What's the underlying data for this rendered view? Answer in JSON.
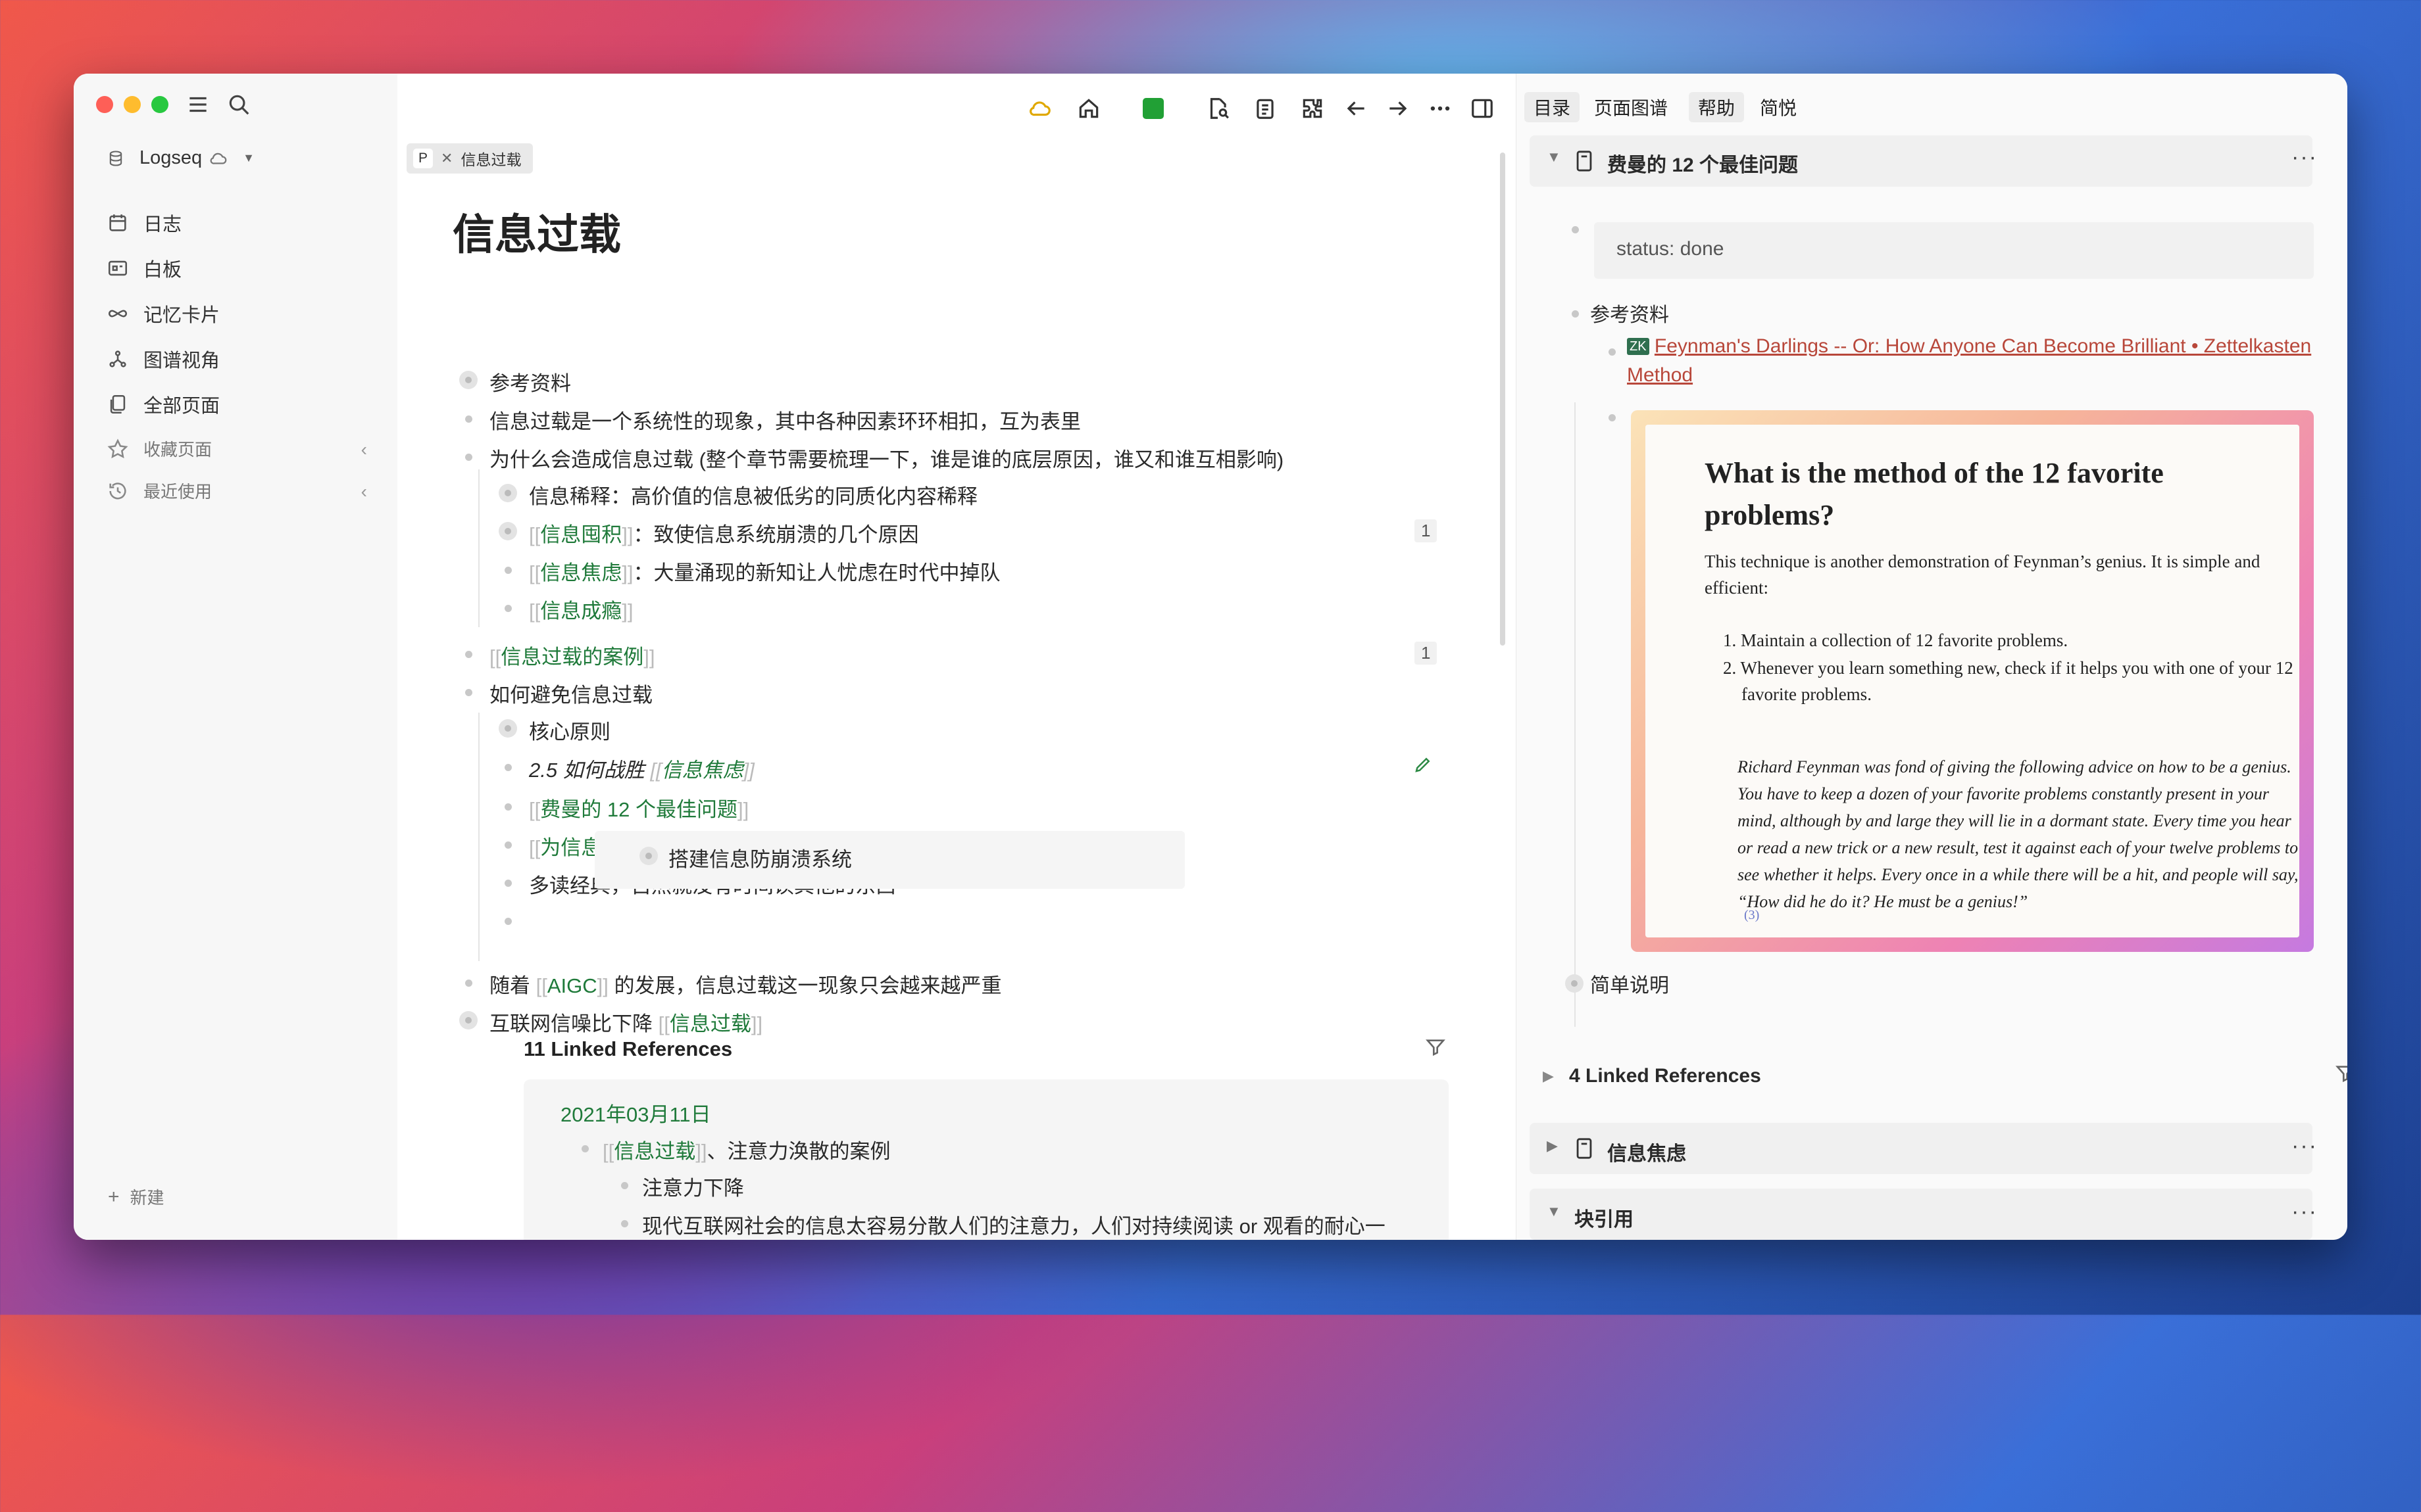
{
  "sidebar": {
    "graph_name": "Logseq",
    "nav": [
      "日志",
      "白板",
      "记忆卡片",
      "图谱视角",
      "全部页面"
    ],
    "favorites": "收藏页面",
    "recent": "最近使用",
    "new_label": "新建"
  },
  "main": {
    "tab_letter": "P",
    "tab_title": "信息过载",
    "page_title": "信息过载",
    "blocks": {
      "b1": "参考资料",
      "b2": "信息过载是一个系统性的现象，其中各种因素环环相扣，互为表里",
      "b3": "为什么会造成信息过载 (整个章节需要梳理一下，谁是谁的底层原因，谁又和谁互相影响)",
      "b3_1": "信息稀释：高价值的信息被低劣的同质化内容稀释",
      "b3_2_link": "信息囤积",
      "b3_2_text": "：致使信息系统崩溃的几个原因",
      "b3_2_count": "1",
      "b3_3_link": "信息焦虑",
      "b3_3_text": "：大量涌现的新知让人忧虑在时代中掉队",
      "b3_4_link": "信息成瘾",
      "b4_link": "信息过载的案例",
      "b4_count": "1",
      "b5": "如何避免信息过载",
      "b5_1": "核心原则",
      "b5_2_text": "2.5 如何战胜",
      "b5_2_link": "信息焦虑",
      "b5_3_link": "费曼的 12 个最佳问题",
      "b5_4_link": "为信息处理设定更小的单位",
      "b5_5": "多读经典，自然就没有时间读其他的东西",
      "b5_6_embed": "搭建信息防崩溃系统",
      "b6_pre": "随着 ",
      "b6_link": "AIGC",
      "b6_post": " 的发展，信息过载这一现象只会越来越严重",
      "b7_pre": "互联网信噪比下降 ",
      "b7_link": "信息过载",
      "open_br": "[[",
      "close_br": "]]"
    },
    "linked_refs": "11 Linked References",
    "ref_date": "2021年03月11日",
    "ref_item1_link": "信息过载",
    "ref_item1_text": "、注意力涣散的案例",
    "ref_item2": "注意力下降",
    "ref_item3": "现代互联网社会的信息太容易分散人们的注意力，人们对持续阅读 or 观看的耐心一"
  },
  "right": {
    "tabs": [
      "目录",
      "页面图谱",
      "帮助",
      "简悦"
    ],
    "card1_title": "费曼的 12 个最佳问题",
    "prop_key": "status:",
    "prop_val": "done",
    "ref_label": "参考资料",
    "ref_link": "Feynman's Darlings -- Or: How Anyone Can Become Brilliant • Zettelkasten",
    "ref_link2": "Method",
    "ref_icon": "ZK",
    "quote": {
      "title": "What is the method of the 12 favorite problems?",
      "p1": "This technique is another demonstration of Feynman’s genius. It is simple and efficient:",
      "li1": "1. Maintain a collection of 12 favorite problems.",
      "li2": "2. Whenever you learn something new, check if it helps you with one of your 12 favorite problems.",
      "italic": "Richard Feynman was fond of giving the following advice on how to be a genius. You have to keep a dozen of your favorite problems constantly present in your mind, although by and large they will lie in a dormant state. Every time you hear or read a new trick or a new result, test it against each of your twelve problems to see whether it helps. Every once in a while there will be a hit, and people will say, “How did he do it? He must be a genius!”",
      "footnote": "(3)"
    },
    "simple_note": "简单说明",
    "linked_refs": "4 Linked References",
    "card2_title": "信息焦虑",
    "card3_title": "块引用"
  }
}
